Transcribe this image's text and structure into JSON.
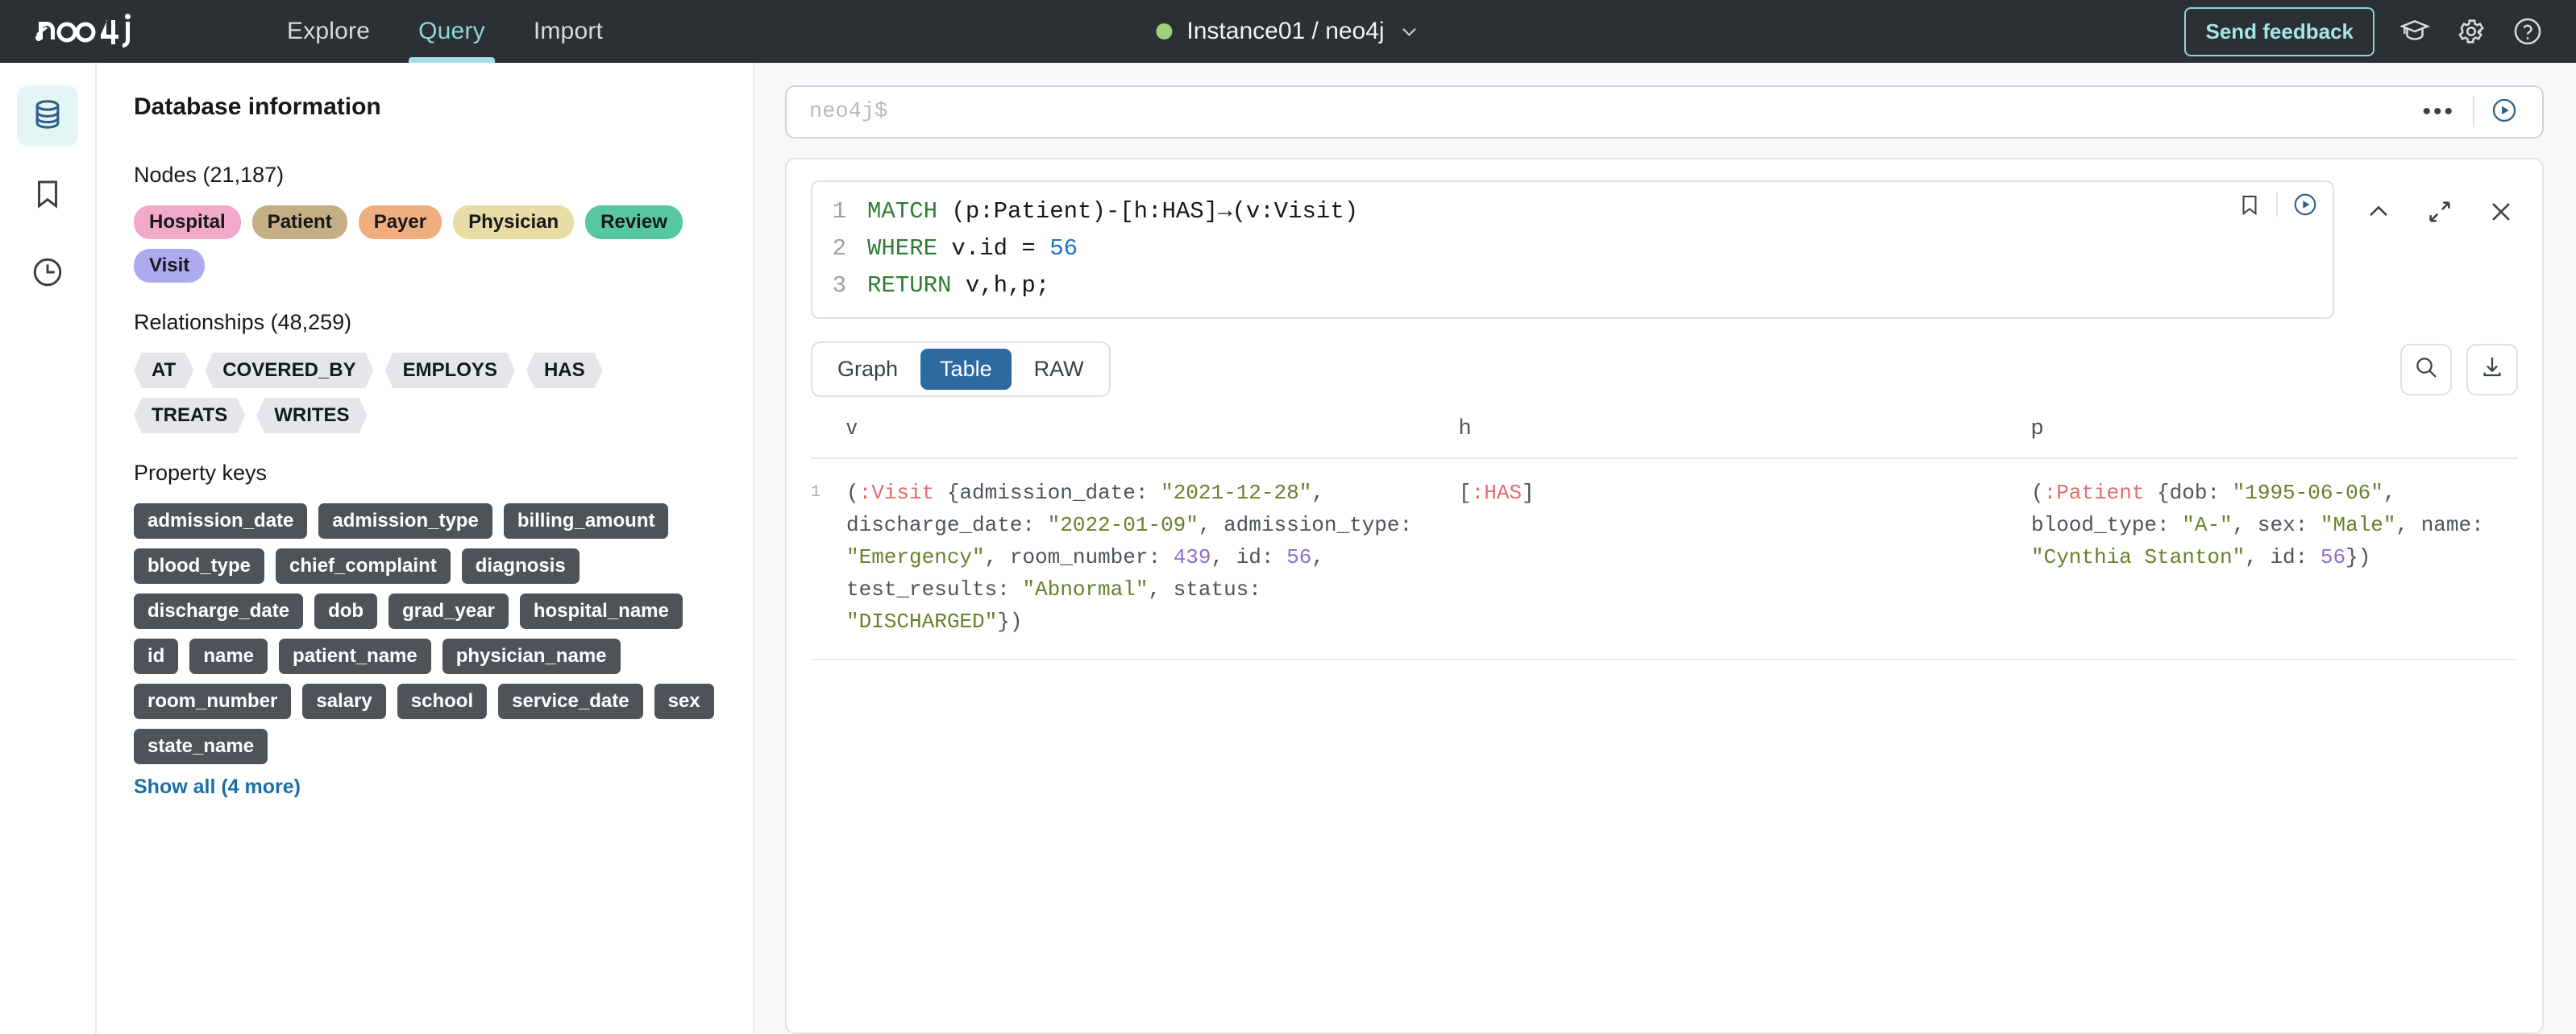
{
  "header": {
    "logo_text": "neo4j",
    "nav": [
      {
        "label": "Explore",
        "active": false
      },
      {
        "label": "Query",
        "active": true
      },
      {
        "label": "Import",
        "active": false
      }
    ],
    "instance_label": "Instance01 / neo4j",
    "status_color": "#9DD178",
    "feedback_label": "Send feedback",
    "icons": [
      "graduation-cap-icon",
      "gear-icon",
      "help-icon"
    ]
  },
  "rail": {
    "items": [
      {
        "name": "database-icon",
        "active": true
      },
      {
        "name": "bookmark-icon",
        "active": false
      },
      {
        "name": "history-clock-icon",
        "active": false
      }
    ]
  },
  "sidebar": {
    "title": "Database information",
    "nodes_heading": "Nodes (21,187)",
    "node_labels": [
      {
        "label": "Hospital",
        "color": "#F0A9C8"
      },
      {
        "label": "Patient",
        "color": "#C4AE83"
      },
      {
        "label": "Payer",
        "color": "#F0AE7F"
      },
      {
        "label": "Physician",
        "color": "#E8DCA6"
      },
      {
        "label": "Review",
        "color": "#57C7A1"
      },
      {
        "label": "Visit",
        "color": "#ADAAF0"
      }
    ],
    "relationships_heading": "Relationships (48,259)",
    "relationship_types": [
      "AT",
      "COVERED_BY",
      "EMPLOYS",
      "HAS",
      "TREATS",
      "WRITES"
    ],
    "property_keys_heading": "Property keys",
    "property_keys": [
      "admission_date",
      "admission_type",
      "billing_amount",
      "blood_type",
      "chief_complaint",
      "diagnosis",
      "discharge_date",
      "dob",
      "grad_year",
      "hospital_name",
      "id",
      "name",
      "patient_name",
      "physician_name",
      "room_number",
      "salary",
      "school",
      "service_date",
      "sex",
      "state_name"
    ],
    "show_all_label": "Show all (4 more)"
  },
  "command_bar": {
    "value": "",
    "placeholder": "neo4j$",
    "more_label": "•••"
  },
  "editor": {
    "lines": [
      {
        "num": "1",
        "tokens": [
          {
            "t": "MATCH",
            "c": "kw"
          },
          {
            "t": " (p:Patient)-[h:HAS]→(v:Visit)",
            "c": "def"
          }
        ]
      },
      {
        "num": "2",
        "tokens": [
          {
            "t": "WHERE",
            "c": "kw"
          },
          {
            "t": " v.id = ",
            "c": "def"
          },
          {
            "t": "56",
            "c": "num"
          }
        ]
      },
      {
        "num": "3",
        "tokens": [
          {
            "t": "RETURN",
            "c": "kw"
          },
          {
            "t": " v,h,p;",
            "c": "def"
          }
        ]
      }
    ],
    "icons": [
      "bookmark-icon",
      "run-icon",
      "collapse-up-icon",
      "expand-icon",
      "close-icon"
    ]
  },
  "results": {
    "tabs": [
      {
        "label": "Graph",
        "active": false
      },
      {
        "label": "Table",
        "active": true
      },
      {
        "label": "RAW",
        "active": false
      }
    ],
    "tools": [
      "search-icon",
      "download-icon"
    ],
    "columns": [
      "v",
      "h",
      "p"
    ],
    "rows": [
      {
        "num": "1",
        "v": [
          {
            "t": "(",
            "c": "punct"
          },
          {
            "t": ":Visit",
            "c": "label"
          },
          {
            "t": " {admission_date: ",
            "c": "punct"
          },
          {
            "t": "\"2021-12-28\"",
            "c": "str"
          },
          {
            "t": ", discharge_date: ",
            "c": "punct"
          },
          {
            "t": "\"2022-01-09\"",
            "c": "str"
          },
          {
            "t": ", admission_type: ",
            "c": "punct"
          },
          {
            "t": "\"Emergency\"",
            "c": "str"
          },
          {
            "t": ", room_number: ",
            "c": "punct"
          },
          {
            "t": "439",
            "c": "num"
          },
          {
            "t": ", id: ",
            "c": "punct"
          },
          {
            "t": "56",
            "c": "num"
          },
          {
            "t": ", test_results: ",
            "c": "punct"
          },
          {
            "t": "\"Abnormal\"",
            "c": "str"
          },
          {
            "t": ", status: ",
            "c": "punct"
          },
          {
            "t": "\"DISCHARGED\"",
            "c": "str"
          },
          {
            "t": "})",
            "c": "punct"
          }
        ],
        "h": [
          {
            "t": "[",
            "c": "punct"
          },
          {
            "t": ":HAS",
            "c": "label"
          },
          {
            "t": "]",
            "c": "punct"
          }
        ],
        "p": [
          {
            "t": "(",
            "c": "punct"
          },
          {
            "t": ":Patient",
            "c": "label"
          },
          {
            "t": " {dob: ",
            "c": "punct"
          },
          {
            "t": "\"1995-06-06\"",
            "c": "str"
          },
          {
            "t": ", blood_type: ",
            "c": "punct"
          },
          {
            "t": "\"A-\"",
            "c": "str"
          },
          {
            "t": ", sex: ",
            "c": "punct"
          },
          {
            "t": "\"Male\"",
            "c": "str"
          },
          {
            "t": ", name: ",
            "c": "punct"
          },
          {
            "t": "\"Cynthia Stanton\"",
            "c": "str"
          },
          {
            "t": ", id: ",
            "c": "punct"
          },
          {
            "t": "56",
            "c": "num"
          },
          {
            "t": "})",
            "c": "punct"
          }
        ]
      }
    ]
  }
}
